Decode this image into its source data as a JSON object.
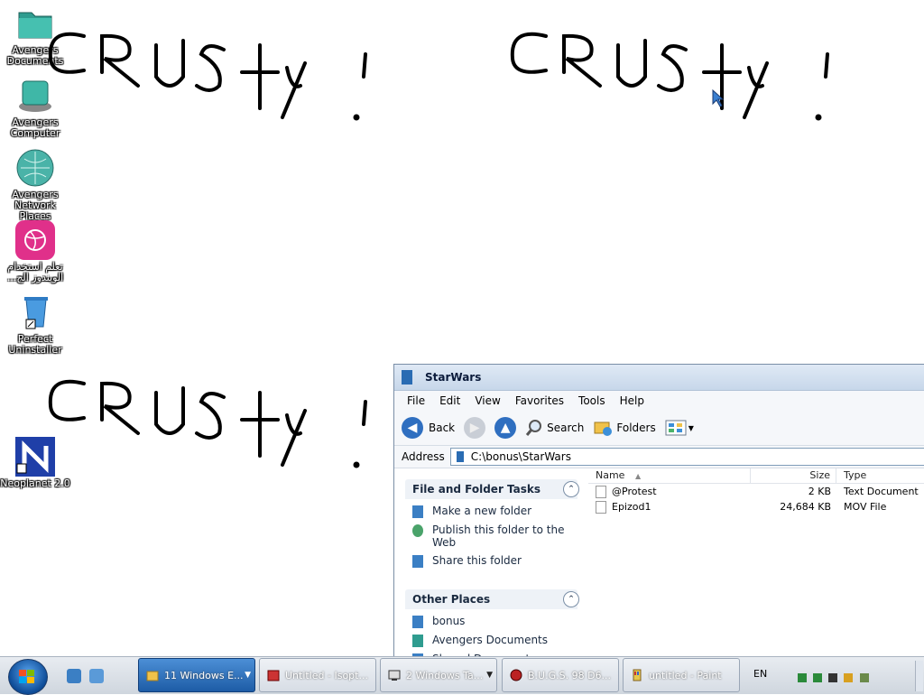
{
  "desktop": {
    "icons": [
      {
        "label": "Avengers\nDocuments",
        "icon": "folder-icon"
      },
      {
        "label": "Avengers\nComputer",
        "icon": "computer-icon"
      },
      {
        "label": "Avengers\nNetwork Places",
        "icon": "network-globe-icon"
      },
      {
        "label": "تعلم استخدام\n...الويندوز الج",
        "icon": "dribbble-ball-icon"
      },
      {
        "label": "Perfect\nUninstaller",
        "icon": "recycle-bin-icon"
      },
      {
        "label": "Neoplanet 2.0",
        "icon": "neoplanet-icon"
      }
    ],
    "scribbles": [
      "CRUSty !",
      "CRUSty !",
      "CRUSty !"
    ]
  },
  "explorer": {
    "title": "StarWars",
    "menu": [
      "File",
      "Edit",
      "View",
      "Favorites",
      "Tools",
      "Help"
    ],
    "toolbar": {
      "back": "Back",
      "search": "Search",
      "folders": "Folders"
    },
    "address_label": "Address",
    "address_value": "C:\\bonus\\StarWars",
    "tasks": {
      "title": "File and Folder Tasks",
      "items": [
        "Make a new folder",
        "Publish this folder to the Web",
        "Share this folder"
      ]
    },
    "places": {
      "title": "Other Places",
      "items": [
        "bonus",
        "Avengers Documents",
        "Shared Documents"
      ]
    },
    "columns": {
      "name": "Name",
      "size": "Size",
      "type": "Type"
    },
    "files": [
      {
        "name": "@Protest",
        "size": "2 KB",
        "type": "Text Document"
      },
      {
        "name": "Epizod1",
        "size": "24,684 KB",
        "type": "MOV File"
      }
    ]
  },
  "taskbar": {
    "buttons": [
      {
        "label": "11 Windows E...",
        "active": true
      },
      {
        "label": "Untitled - Isopt...",
        "active": false
      },
      {
        "label": "2 Windows Ta...",
        "active": false
      },
      {
        "label": "B.U.G.S. 98 D6...",
        "active": false
      },
      {
        "label": "untitled - Paint",
        "active": false
      }
    ],
    "language": "EN"
  }
}
